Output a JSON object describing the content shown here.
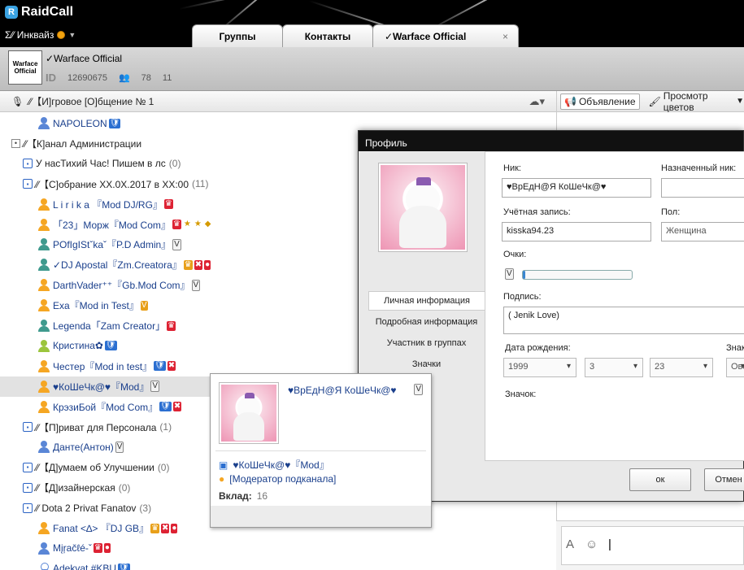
{
  "app": {
    "name": "RaidCall",
    "logo_glyph": "R",
    "username": "Σ⁄⁄ Инквайз",
    "tabs": [
      {
        "label": "Группы"
      },
      {
        "label": "Контакты"
      },
      {
        "label": "✓Warface Official",
        "close": "×"
      }
    ]
  },
  "group": {
    "logo_lines": [
      "Warface",
      "Official"
    ],
    "name": "✓Warface Official",
    "id_label": "ID",
    "id": "12690675",
    "members": "78",
    "extra": "11"
  },
  "channel_header": {
    "title": "⁄⁄【И]гровое [О]бщение № 1"
  },
  "right_header": {
    "announce_label": "Объявление",
    "colors_label": "Просмотр цветов"
  },
  "tree": [
    {
      "kind": "user",
      "avatar": "bl",
      "name": "NAPOLEON",
      "badges": [
        {
          "t": "🛡",
          "c": "b-sh"
        }
      ]
    },
    {
      "kind": "channel",
      "icon": "expand",
      "name": "⁄⁄【К]анал Администрации",
      "count": ""
    },
    {
      "kind": "channel",
      "icon": "lock",
      "name": "У насТихий Час! Пишем в лс",
      "count": "(0)"
    },
    {
      "kind": "channel",
      "icon": "lock",
      "name": "⁄⁄【С]обрание XX.0X.2017 в XX:00",
      "count": "(11)"
    },
    {
      "kind": "user",
      "avatar": "or",
      "name": "L i r i k a 『Mod DJ/RG』",
      "badges": [
        {
          "t": "♛",
          "c": "b-red"
        }
      ]
    },
    {
      "kind": "user",
      "avatar": "or",
      "name": "「23」Морж『Mod Com』",
      "badges": [
        {
          "t": "♛",
          "c": "b-red"
        },
        {
          "t": "★",
          "c": "b-st"
        },
        {
          "t": "★",
          "c": "b-st"
        },
        {
          "t": "◆",
          "c": "b-st"
        }
      ]
    },
    {
      "kind": "user",
      "avatar": "te",
      "name": "POfIgIStˇkaˇ『P.D Admin』",
      "badges": [
        {
          "t": "V",
          "c": "b-v"
        }
      ]
    },
    {
      "kind": "user",
      "avatar": "te",
      "name": "✓DJ Apostal『Zm.Creatora』",
      "badges": [
        {
          "t": "♛",
          "c": "b-gold"
        },
        {
          "t": "✖",
          "c": "b-red"
        },
        {
          "t": "●",
          "c": "b-red"
        }
      ]
    },
    {
      "kind": "user",
      "avatar": "or",
      "name": "DarthVader⁺⁺『Gb.Mod Com』",
      "badges": [
        {
          "t": "V",
          "c": "b-v"
        }
      ]
    },
    {
      "kind": "user",
      "avatar": "or",
      "name": "Exa『Mod in Test』",
      "badges": [
        {
          "t": "V",
          "c": "b-gold"
        }
      ]
    },
    {
      "kind": "user",
      "avatar": "te",
      "name": "Legenda「Zam Creator」",
      "badges": [
        {
          "t": "♛",
          "c": "b-red"
        }
      ]
    },
    {
      "kind": "user",
      "avatar": "gn",
      "name": "Кристина✿",
      "badges": [
        {
          "t": "🛡",
          "c": "b-sh"
        }
      ]
    },
    {
      "kind": "user",
      "avatar": "or",
      "name": "Честер『Mod in test』",
      "badges": [
        {
          "t": "🛡",
          "c": "b-sh"
        },
        {
          "t": "✖",
          "c": "b-red"
        }
      ]
    },
    {
      "kind": "user",
      "avatar": "or",
      "name": "♥КоШеЧк@♥『Mod』",
      "badges": [
        {
          "t": "V",
          "c": "b-v"
        }
      ],
      "selected": true
    },
    {
      "kind": "user",
      "avatar": "or",
      "name": "КрэзиБой『Mod Com』",
      "badges": [
        {
          "t": "🛡",
          "c": "b-sh"
        },
        {
          "t": "✖",
          "c": "b-red"
        }
      ]
    },
    {
      "kind": "channel",
      "icon": "lock",
      "name": "⁄⁄【П]риват для Персонала",
      "count": "(1)"
    },
    {
      "kind": "user",
      "avatar": "bl",
      "name": "Данте(Антон)",
      "badges": [
        {
          "t": "V",
          "c": "b-v"
        }
      ]
    },
    {
      "kind": "channel",
      "icon": "lock",
      "name": "⁄⁄【Д]умаем об Улучшении",
      "count": "(0)"
    },
    {
      "kind": "channel",
      "icon": "lock",
      "name": "⁄⁄【Д]изайнерская",
      "count": "(0)"
    },
    {
      "kind": "channel",
      "icon": "lock",
      "name": "⁄⁄ Dota 2 Privat Fanatov",
      "count": "(3)"
    },
    {
      "kind": "user",
      "avatar": "or",
      "name": "Fanat <∆> 『DJ GB』",
      "badges": [
        {
          "t": "♛",
          "c": "b-gold"
        },
        {
          "t": "✖",
          "c": "b-red"
        },
        {
          "t": "●",
          "c": "b-red"
        }
      ]
    },
    {
      "kind": "user",
      "avatar": "bl",
      "name": "Mįŗačℓé-ˇ",
      "badges": [
        {
          "t": "♛",
          "c": "b-red"
        },
        {
          "t": "●",
          "c": "b-red"
        }
      ]
    },
    {
      "kind": "user",
      "avatar": "out",
      "name": "Adekvat #KBU",
      "badges": [
        {
          "t": "🛡",
          "c": "b-sh"
        }
      ]
    }
  ],
  "profile": {
    "title": "Профиль",
    "nav": [
      "Личная информация",
      "Подробная информация",
      "Участник в группах",
      "Значки"
    ],
    "labels": {
      "nick": "Ник:",
      "assigned_nick": "Назначенный ник:",
      "account": "Учётная запись:",
      "gender": "Пол:",
      "points": "Очки:",
      "signature": "Подпись:",
      "birth": "Дата рождения:",
      "zodiac": "Знак",
      "badge": "Значок:"
    },
    "values": {
      "nick": "♥ВрЕдН@Я КоШеЧк@♥",
      "assigned_nick": "",
      "account": "kisska94.23",
      "gender": "Женщина",
      "signature": "( Jenik Love)",
      "birth_year": "1999",
      "birth_month": "3",
      "birth_day": "23",
      "zodiac": "Ове"
    },
    "points_fraction": 0.02,
    "ok_label": "ок",
    "cancel_label": "Отмен"
  },
  "card": {
    "name": "♥ВрЕдН@Я КоШеЧк@♥",
    "nick": "♥КоШеЧк@♥『Mod』",
    "role": "[Модератор подканала]",
    "contrib_label": "Вклад:",
    "contrib_value": "16"
  }
}
